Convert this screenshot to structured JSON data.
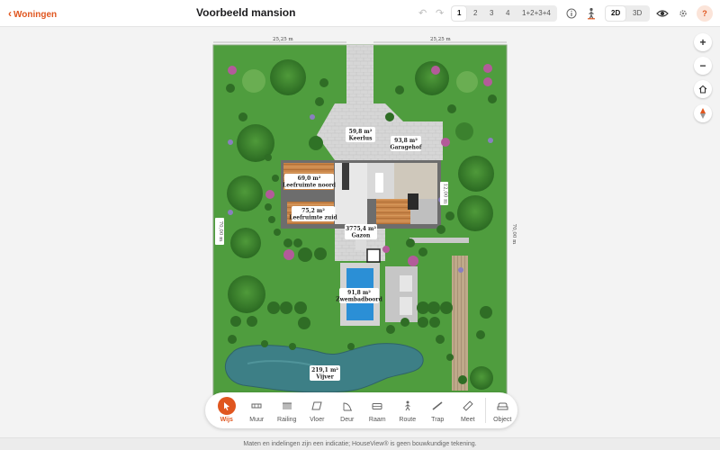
{
  "header": {
    "back_label": "Woningen",
    "title": "Voorbeeld mansion",
    "floors": [
      "1",
      "2",
      "3",
      "4",
      "1+2+3+4"
    ],
    "active_floor": "1",
    "views": [
      "2D",
      "3D"
    ],
    "active_view": "2D",
    "help_label": "?"
  },
  "plan": {
    "dimensions": {
      "top_left": "25,25 m",
      "top_right": "25,25 m",
      "side_left": "70,00 m",
      "side_right": "70,00 m",
      "inner": "12,00 m"
    },
    "rooms": [
      {
        "area": "59,8 m²",
        "name": "Keerlus"
      },
      {
        "area": "93,8 m²",
        "name": "Garagehof"
      },
      {
        "area": "69,0 m²",
        "name": "Leefruimte noord"
      },
      {
        "area": "75,2 m²",
        "name": "Leefruimte zuid"
      },
      {
        "area": "3775,4 m²",
        "name": "Gazon"
      },
      {
        "area": "91,8 m²",
        "name": "Zwembadboord"
      },
      {
        "area": "219,1 m²",
        "name": "Vijver"
      }
    ]
  },
  "tools": [
    {
      "label": "Wijs",
      "icon": "cursor-icon"
    },
    {
      "label": "Muur",
      "icon": "wall-icon"
    },
    {
      "label": "Railing",
      "icon": "railing-icon"
    },
    {
      "label": "Vloer",
      "icon": "floor-icon"
    },
    {
      "label": "Deur",
      "icon": "door-icon"
    },
    {
      "label": "Raam",
      "icon": "window-icon"
    },
    {
      "label": "Route",
      "icon": "route-icon"
    },
    {
      "label": "Trap",
      "icon": "stairs-icon"
    },
    {
      "label": "Meet",
      "icon": "ruler-icon"
    },
    {
      "label": "Object",
      "icon": "sofa-icon"
    }
  ],
  "active_tool": "Wijs",
  "footer": {
    "disclaimer": "Maten en indelingen zijn een indicatie; HouseView® is geen bouwkundige tekening."
  },
  "colors": {
    "accent": "#e0561f",
    "lawn": "#4c9a3c",
    "pool": "#2b8fd6",
    "pond": "#3d7f86",
    "paving": "#cfcfcf"
  }
}
